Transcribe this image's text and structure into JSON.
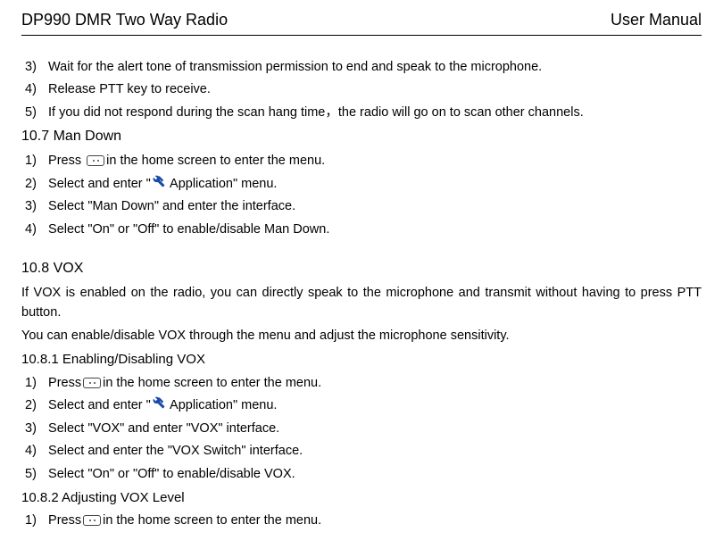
{
  "header": {
    "left": "DP990 DMR Two Way Radio",
    "right": "User Manual"
  },
  "content": {
    "list1": [
      {
        "num": "3)",
        "text": "Wait for the alert tone of transmission permission to end and speak to the microphone."
      },
      {
        "num": "4)",
        "text": "Release PTT key to receive."
      },
      {
        "num": "5)",
        "text": "If you did not respond during the scan hang time，the radio will go on to scan other channels."
      }
    ],
    "sec107": {
      "heading": "10.7    Man Down",
      "items": [
        {
          "num": "1)",
          "pre": "Press  ",
          "icon": "menu-key",
          "post": "in the home screen to enter the menu."
        },
        {
          "num": "2)",
          "pre": "Select and enter \"",
          "icon": "tools",
          "post": "  Application\" menu."
        },
        {
          "num": "3)",
          "text": "Select \"Man Down\" and enter the interface."
        },
        {
          "num": "4)",
          "text": "Select \"On\" or \"Off\" to enable/disable Man Down."
        }
      ]
    },
    "sec108": {
      "heading": "10.8    VOX",
      "para1": "If VOX is enabled on the radio, you can directly speak to the microphone and transmit without having to press PTT button.",
      "para2": "You can enable/disable VOX through the menu and adjust the microphone sensitivity.",
      "sub1": {
        "heading": "10.8.1    Enabling/Disabling VOX",
        "items": [
          {
            "num": "1)",
            "pre": "Press",
            "icon": "menu-key",
            "post": "in the home screen to enter the menu."
          },
          {
            "num": "2)",
            "pre": "Select and enter \"",
            "icon": "tools",
            "post": "  Application\" menu."
          },
          {
            "num": "3)",
            "text": "Select \"VOX\" and enter \"VOX\" interface."
          },
          {
            "num": "4)",
            "text": "Select and enter the \"VOX Switch\" interface."
          },
          {
            "num": "5)",
            "text": "Select \"On\" or \"Off\" to enable/disable VOX."
          }
        ]
      },
      "sub2": {
        "heading": "10.8.2    Adjusting VOX Level",
        "items": [
          {
            "num": "1)",
            "pre": "Press",
            "icon": "menu-key",
            "post": "in the home screen to enter the menu."
          }
        ]
      }
    }
  }
}
